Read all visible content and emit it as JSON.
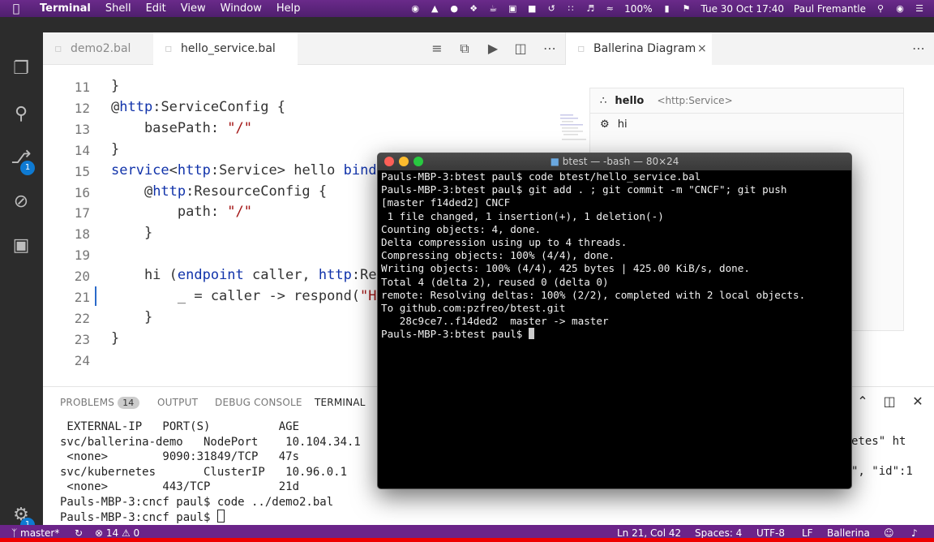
{
  "menubar": {
    "app": "Terminal",
    "items": [
      "Shell",
      "Edit",
      "View",
      "Window",
      "Help"
    ],
    "battery": "100%",
    "datetime": "Tue 30 Oct  17:40",
    "user": "Paul Fremantle"
  },
  "vscode": {
    "tabs": [
      "demo2.bal",
      "hello_service.bal"
    ],
    "right_tab": "Ballerina Diagram",
    "diagram": {
      "service_name": "hello",
      "service_type": "<http:Service>",
      "resource_name": "hi"
    },
    "editor_lines": [
      {
        "n": "11",
        "text": "}"
      },
      {
        "n": "12",
        "text": "@http:ServiceConfig {"
      },
      {
        "n": "13",
        "text": "    basePath: \"/\""
      },
      {
        "n": "14",
        "text": "}"
      },
      {
        "n": "15",
        "text": "service<http:Service> hello bind"
      },
      {
        "n": "16",
        "text": "    @http:ResourceConfig {"
      },
      {
        "n": "17",
        "text": "        path: \"/\""
      },
      {
        "n": "18",
        "text": "    }"
      },
      {
        "n": "19",
        "text": ""
      },
      {
        "n": "20",
        "text": "    hi (endpoint caller, http:Re"
      },
      {
        "n": "21",
        "text": "        _ = caller -> respond(\"H"
      },
      {
        "n": "22",
        "text": "    }"
      },
      {
        "n": "23",
        "text": "}"
      },
      {
        "n": "24",
        "text": ""
      }
    ],
    "panel": {
      "tabs": [
        "PROBLEMS",
        "OUTPUT",
        "DEBUG CONSOLE",
        "TERMINAL"
      ],
      "problems_count": "14",
      "terminal_lines": [
        " EXTERNAL-IP   PORT(S)          AGE",
        "svc/ballerina-demo   NodePort    10.104.34.1",
        " <none>        9090:31849/TCP   47s",
        "svc/kubernetes       ClusterIP   10.96.0.1",
        " <none>        443/TCP          21d",
        "Pauls-MBP-3:cncf paul$ code ../demo2.bal",
        "Pauls-MBP-3:cncf paul$ "
      ],
      "right_text_1": "etes\" ht",
      "right_text_2": "\", \"id\":1"
    },
    "status": {
      "branch": "master*",
      "errors": "14",
      "warnings": "0",
      "position": "Ln 21, Col 42",
      "spaces": "Spaces: 4",
      "encoding": "UTF-8",
      "eol": "LF",
      "language": "Ballerina",
      "settings_badge": "1",
      "scm_badge": "1"
    }
  },
  "terminal": {
    "title": "btest — -bash — 80×24",
    "lines": [
      "Pauls-MBP-3:btest paul$ code btest/hello_service.bal",
      "Pauls-MBP-3:btest paul$ git add . ; git commit -m \"CNCF\"; git push",
      "[master f14ded2] CNCF",
      " 1 file changed, 1 insertion(+), 1 deletion(-)",
      "Counting objects: 4, done.",
      "Delta compression using up to 4 threads.",
      "Compressing objects: 100% (4/4), done.",
      "Writing objects: 100% (4/4), 425 bytes | 425.00 KiB/s, done.",
      "Total 4 (delta 2), reused 0 (delta 0)",
      "remote: Resolving deltas: 100% (2/2), completed with 2 local objects.",
      "To github.com:pzfreo/btest.git",
      "   28c9ce7..f14ded2  master -> master",
      "Pauls-MBP-3:btest paul$ "
    ]
  },
  "colors": {
    "menubar": "#5a2479",
    "statusbar": "#6b2489",
    "keyword": "#1133aa",
    "string": "#a31515"
  }
}
